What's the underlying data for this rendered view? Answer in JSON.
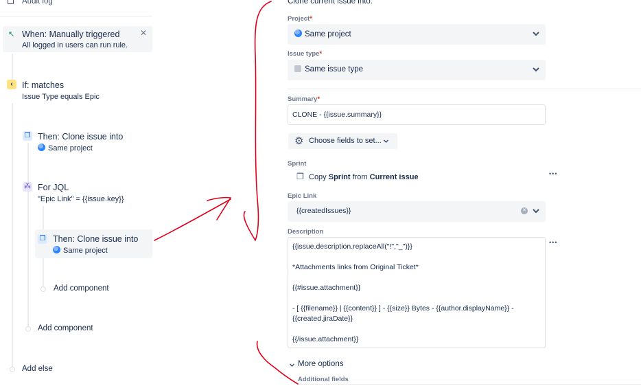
{
  "left": {
    "audit_log": "Audit log",
    "trigger": {
      "title": "When: Manually triggered",
      "subtitle": "All logged in users can run rule."
    },
    "condition": {
      "title": "If: matches",
      "subtitle": "Issue Type equals Epic"
    },
    "action1": {
      "title": "Then: Clone issue into",
      "subtitle": "Same project"
    },
    "branch": {
      "title": "For JQL",
      "subtitle": "\"Epic Link\" = {{issue.key}}"
    },
    "action2": {
      "title": "Then: Clone issue into",
      "subtitle": "Same project"
    },
    "add_component_inner": "Add component",
    "add_component_outer": "Add component",
    "add_else": "Add else"
  },
  "form": {
    "heading": "Clone current issue into:",
    "project": {
      "label": "Project",
      "value": "Same project"
    },
    "issue_type": {
      "label": "Issue type",
      "value": "Same issue type"
    },
    "summary": {
      "label": "Summary",
      "value": "CLONE - {{issue.summary}}"
    },
    "choose_fields": "Choose fields to set...",
    "sprint": {
      "label": "Sprint",
      "pre": "Copy ",
      "field": "Sprint",
      "mid": " from ",
      "source": "Current issue"
    },
    "epic_link": {
      "label": "Epic Link",
      "value": "{{createdIssues}}"
    },
    "description": {
      "label": "Description",
      "lines": [
        "{{issue.description.replaceAll(\"!\",\"_\")}}",
        "*Attachments links from Original Ticket*",
        "{{#issue.attachment}}",
        "- [ {{filename}} | {{content}} ] - {{size}} Bytes - {{author.displayName}} -",
        "{{created.jiraDate}}",
        "{{/issue.attachment}}"
      ]
    },
    "more_options": "More options",
    "additional_fields": "Additional fields",
    "required_mark": "*",
    "ellipsis": "•••"
  },
  "colors": {
    "annotation": "#e0001b",
    "trigger_icon": "#00875a",
    "condition_icon": "#ffab00",
    "action_icon": "#4c9aff",
    "branch_icon": "#6554c0"
  }
}
